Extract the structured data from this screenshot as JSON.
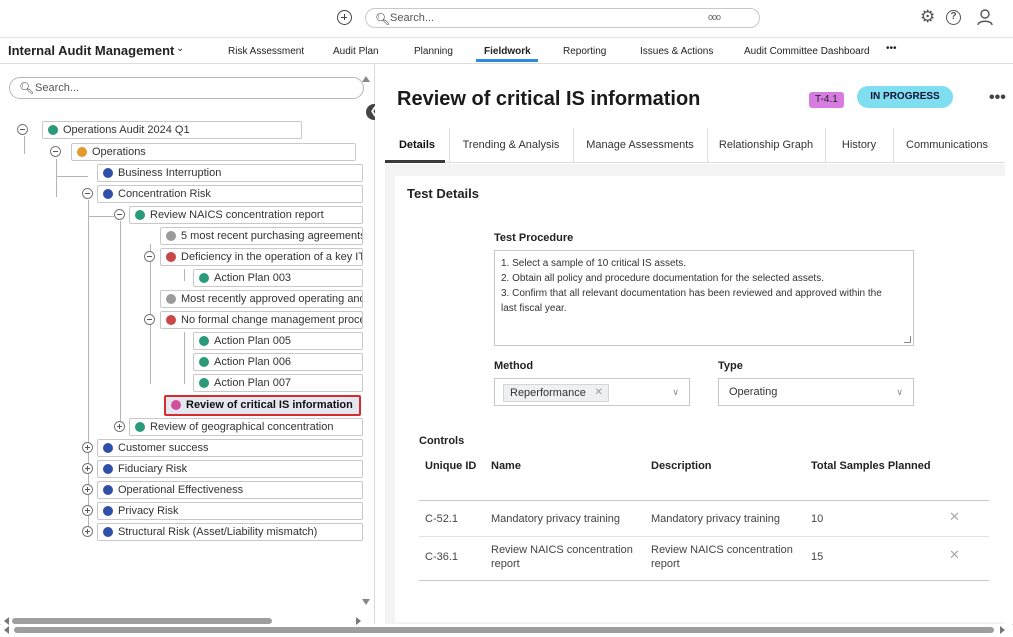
{
  "topbar": {
    "search_placeholder": "Search...",
    "more_dots": "ooo"
  },
  "nav": {
    "app_title": "Internal Audit Management",
    "items": [
      "Risk Assessment",
      "Audit Plan",
      "Planning",
      "Fieldwork",
      "Reporting",
      "Issues & Actions",
      "Audit Committee Dashboard",
      "•••"
    ],
    "active": "Fieldwork"
  },
  "tree": {
    "search_placeholder": "Search...",
    "nodes": [
      "Operations Audit 2024 Q1",
      "Operations",
      "Business Interruption",
      "Concentration Risk",
      "Review NAICS concentration report",
      "5 most recent purchasing agreements",
      "Deficiency in the operation of a key IT",
      "Action Plan 003",
      "Most recently approved operating and",
      "No formal change management proce",
      "Action Plan 005",
      "Action Plan 006",
      "Action Plan 007",
      "Review of critical IS information",
      "Review of geographical concentration",
      "Customer success",
      "Fiduciary Risk",
      "Operational Effectiveness",
      "Privacy Risk",
      "Structural Risk (Asset/Liability mismatch)"
    ],
    "selected": "Review of critical IS information"
  },
  "detail": {
    "title": "Review of critical IS information",
    "id_badge": "T-4.1",
    "status": "IN PROGRESS",
    "tabs": [
      "Details",
      "Trending & Analysis",
      "Manage Assessments",
      "Relationship Graph",
      "History",
      "Communications"
    ],
    "active_tab": "Details",
    "section_title": "Test Details",
    "test_procedure_label": "Test Procedure",
    "test_procedure_lines": [
      "1. Select a sample of 10 critical IS assets.",
      "2. Obtain all policy and procedure documentation for the selected assets.",
      "3. Confirm that all relevant documentation has been reviewed and approved within the",
      "last fiscal year."
    ],
    "method_label": "Method",
    "method_value": "Reperformance",
    "type_label": "Type",
    "type_value": "Operating",
    "controls_label": "Controls",
    "controls_headers": [
      "Unique ID",
      "Name",
      "Description",
      "Total Samples Planned"
    ],
    "controls_rows": [
      {
        "id": "C-52.1",
        "name": "Mandatory privacy training",
        "desc": "Mandatory privacy training",
        "samples": "10"
      },
      {
        "id": "C-36.1",
        "name": "Review NAICS concentration report",
        "desc": "Review NAICS concentration report",
        "samples": "15"
      }
    ]
  },
  "colors": {
    "accent": "#2c8be0",
    "status_badge": "#7fdff0",
    "id_badge": "#d67ce0",
    "selection_border": "#d52d2d"
  }
}
